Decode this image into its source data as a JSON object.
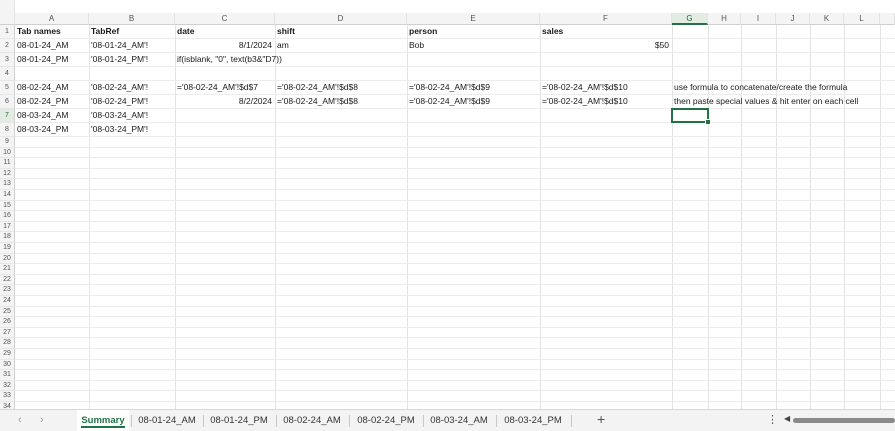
{
  "columns": [
    "A",
    "B",
    "C",
    "D",
    "E",
    "F",
    "G",
    "H",
    "I",
    "J",
    "K",
    "L"
  ],
  "selected_column": "G",
  "rows": [
    "1",
    "2",
    "3",
    "4",
    "5",
    "6",
    "7",
    "8",
    "9",
    "10",
    "11",
    "12",
    "13",
    "14",
    "15",
    "16",
    "17",
    "18",
    "19",
    "20",
    "21",
    "22",
    "23",
    "24",
    "25",
    "26",
    "27",
    "28",
    "29",
    "30",
    "31",
    "32",
    "33",
    "34"
  ],
  "selected_row": "7",
  "headers": {
    "A": "Tab names",
    "B": "TabRef",
    "C": "date",
    "D": "shift",
    "E": "person",
    "F": "sales"
  },
  "cells": {
    "A2": "08-01-24_AM",
    "B2": "'08-01-24_AM'!",
    "C2": "8/1/2024",
    "D2": "am",
    "E2": "Bob",
    "F2": "$50",
    "A3": "08-01-24_PM",
    "B3": "'08-01-24_PM'!",
    "C3": "if(isblank, \"0\", text(b3&\"D7))",
    "A5": "08-02-24_AM",
    "B5": "'08-02-24_AM'!",
    "C5": "='08-02-24_AM'!$d$7",
    "D5": "='08-02-24_AM'!$d$8",
    "E5": "='08-02-24_AM'!$d$9",
    "F5": "='08-02-24_AM'!$d$10",
    "G5": "use formula to concatenate/create the formula",
    "A6": "08-02-24_PM",
    "B6": "'08-02-24_PM'!",
    "C6": "8/2/2024",
    "D6": "='08-02-24_AM'!$d$8",
    "E6": "='08-02-24_AM'!$d$9",
    "F6": "='08-02-24_AM'!$d$10",
    "G6": "then paste special values & hit enter on each cell",
    "A7": "08-03-24_AM",
    "B7": "'08-03-24_AM'!",
    "A8": "08-03-24_PM",
    "B8": "'08-03-24_PM'!"
  },
  "sheet_tabs": [
    "Summary",
    "08-01-24_AM",
    "08-01-24_PM",
    "08-02-24_AM",
    "08-02-24_PM",
    "08-03-24_AM",
    "08-03-24_PM"
  ],
  "active_tab": "Summary",
  "icons": {
    "prev": "chevron-left-icon",
    "next": "chevron-right-icon",
    "add": "plus-icon",
    "more": "vertical-ellipsis-icon",
    "scroll_left": "triangle-left-icon"
  },
  "colors": {
    "accent": "#217346"
  }
}
